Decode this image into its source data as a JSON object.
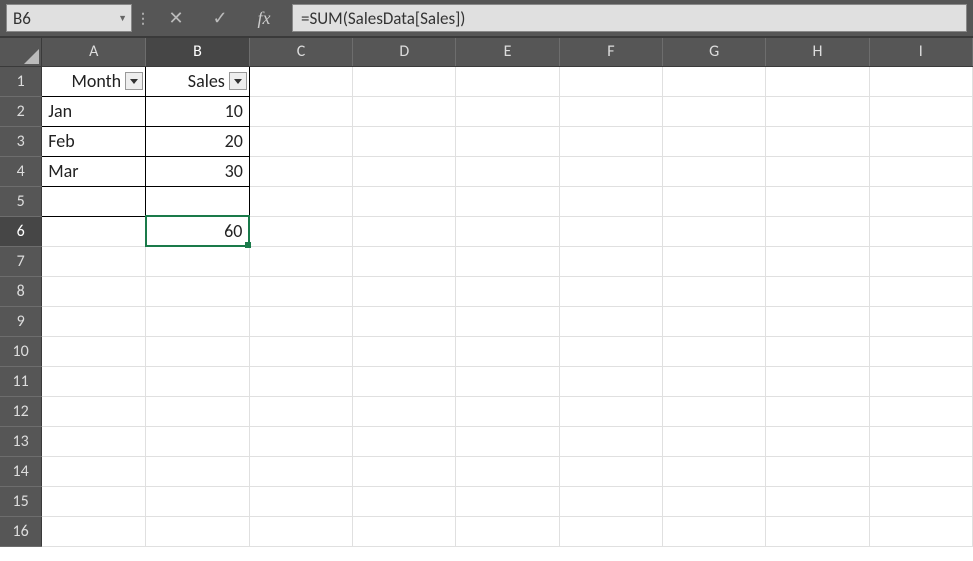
{
  "formula_bar": {
    "cell_ref": "B6",
    "formula": "=SUM(SalesData[Sales])",
    "cancel_glyph": "✕",
    "confirm_glyph": "✓",
    "fx_label": "fx",
    "sep_glyph": "⋮"
  },
  "columns": [
    "A",
    "B",
    "C",
    "D",
    "E",
    "F",
    "G",
    "H",
    "I"
  ],
  "rows": [
    "1",
    "2",
    "3",
    "4",
    "5",
    "6",
    "7",
    "8",
    "9",
    "10",
    "11",
    "12",
    "13",
    "14",
    "15",
    "16"
  ],
  "active_col": "B",
  "active_row": "6",
  "table": {
    "headers": {
      "A": "Month",
      "B": "Sales"
    },
    "data": [
      {
        "A": "Jan",
        "B": "10"
      },
      {
        "A": "Feb",
        "B": "20"
      },
      {
        "A": "Mar",
        "B": "30"
      },
      {
        "A": "",
        "B": ""
      }
    ],
    "sum_cell": {
      "ref": "B6",
      "value": "60"
    }
  }
}
